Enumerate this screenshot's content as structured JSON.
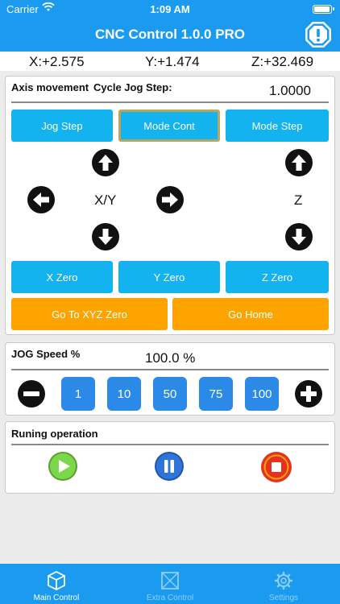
{
  "status_bar": {
    "carrier": "Carrier",
    "time": "1:09 AM"
  },
  "header": {
    "title": "CNC Control 1.0.0 PRO"
  },
  "coordinates": {
    "x": "X:+2.575",
    "y": "Y:+1.474",
    "z": "Z:+32.469"
  },
  "axis_panel": {
    "axis_label": "Axis movement",
    "cycle_label": "Cycle Jog Step:",
    "cycle_value": "1.0000",
    "mode_buttons": [
      "Jog Step",
      "Mode Cont",
      "Mode Step"
    ],
    "active_mode": "Mode Cont",
    "xy_label": "X/Y",
    "z_label": "Z",
    "zero_buttons": [
      "X Zero",
      "Y Zero",
      "Z Zero"
    ],
    "goto_xyz_zero": "Go To XYZ Zero",
    "go_home": "Go Home"
  },
  "jog_speed": {
    "label": "JOG Speed %",
    "value": "100.0 %",
    "presets": [
      "1",
      "10",
      "50",
      "75",
      "100"
    ]
  },
  "running": {
    "label": "Runing operation"
  },
  "tabs": [
    {
      "label": "Main Control",
      "icon": "cube-icon",
      "selected": true
    },
    {
      "label": "Extra Control",
      "icon": "box-icon",
      "selected": false
    },
    {
      "label": "Settings",
      "icon": "gear-icon",
      "selected": false
    }
  ],
  "colors": {
    "accent": "#1a9bf0",
    "button_blue": "#12b3ef",
    "button_orange": "#ffa300",
    "preset_blue": "#2b8ae8",
    "play_green": "#7bd84a",
    "pause_blue": "#2f74d8",
    "stop_red": "#e53121"
  }
}
